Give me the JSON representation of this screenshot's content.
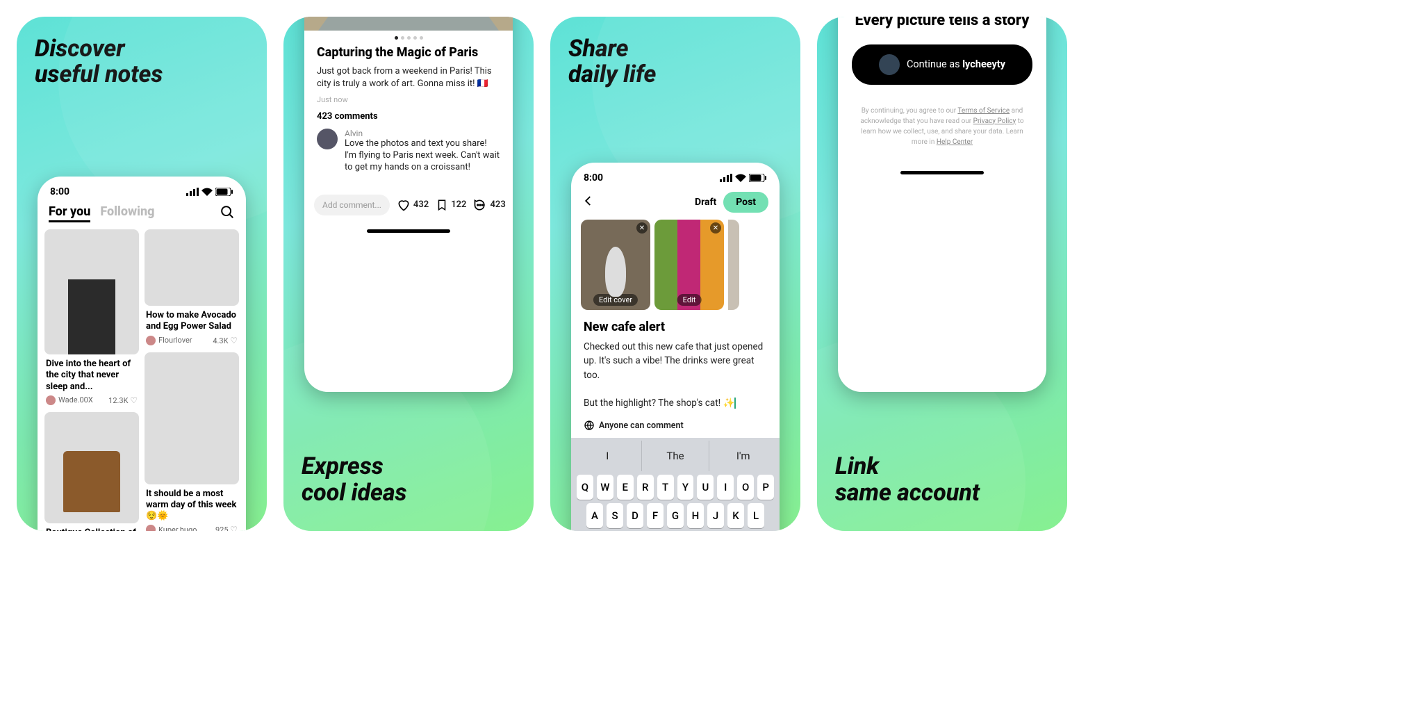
{
  "panel1": {
    "headline": "Discover\nuseful notes",
    "statusTime": "8:00",
    "tabs": {
      "forYou": "For you",
      "following": "Following"
    },
    "cards": {
      "city": {
        "title": "Dive into the heart of the city that never sleep and...",
        "user": "Wade.00X",
        "likes": "12.3K"
      },
      "salad": {
        "title": "How to make Avocado and Egg Power Salad",
        "user": "Flourlover",
        "likes": "4.3K"
      },
      "boots": {
        "title": "Boutique Collection of Autumn Short Boots"
      },
      "yosemite": {
        "title": "It should be a most warm day of this week 😌🌞",
        "user": "Kuper.hugo",
        "likes": "925"
      }
    }
  },
  "panel2": {
    "post": {
      "title": "Capturing the Magic of Paris",
      "body": "Just got back from a weekend in Paris! This city is truly a work of art. Gonna miss it! 🇫🇷",
      "time": "Just now",
      "commentsHeader": "423 comments",
      "comment": {
        "user": "Alvin",
        "text": "Love the photos and text you share! I'm flying to Paris next week. Can't wait to get my hands on a croissant!"
      },
      "addCommentPlaceholder": "Add comment...",
      "likes": "432",
      "bookmarks": "122",
      "commentsCount": "423"
    },
    "headline": "Express\ncool ideas"
  },
  "panel3": {
    "headline": "Share\ndaily life",
    "statusTime": "8:00",
    "draftLabel": "Draft",
    "postLabel": "Post",
    "thumbs": {
      "editCover": "Edit cover",
      "edit": "Edit"
    },
    "composeTitle": "New cafe alert",
    "composeBody1": "Checked out this new cafe that just opened up. It's such a vibe! The drinks were great too.",
    "composeBody2": "But the highlight? The shop's cat! ✨",
    "audience": "Anyone can comment",
    "keyboard": {
      "suggest": [
        "I",
        "The",
        "I'm"
      ],
      "row1": [
        "Q",
        "W",
        "E",
        "R",
        "T",
        "Y",
        "U",
        "I",
        "O",
        "P"
      ],
      "row2": [
        "A",
        "S",
        "D",
        "F",
        "G",
        "H",
        "J",
        "K",
        "L"
      ]
    }
  },
  "panel4": {
    "storyHeadline": "Every picture tells a story",
    "continuePrefix": "Continue as ",
    "continueUser": "lycheeyty",
    "legal": {
      "l1a": "By continuing, you agree to our ",
      "tos": "Terms of Service",
      "l1b": " and acknowledge that you have read our ",
      "priv": "Privacy Policy",
      "l1c": " to learn how we collect, use, and share your data. Learn more in ",
      "help": "Help Center"
    },
    "headline": "Link\nsame account"
  }
}
